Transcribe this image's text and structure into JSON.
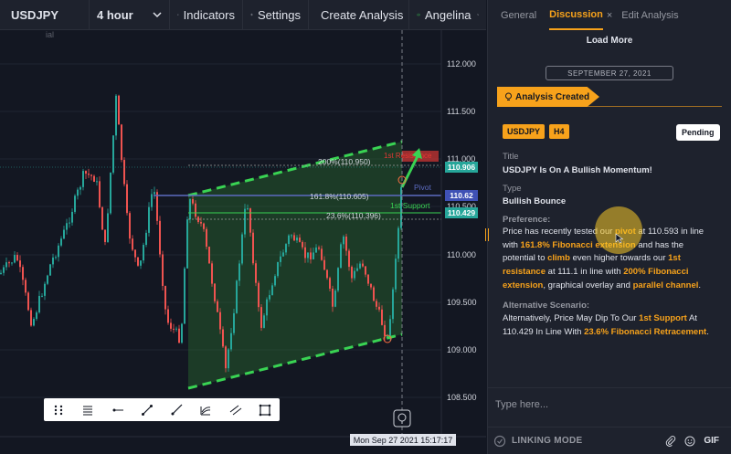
{
  "topbar": {
    "symbol": "USDJPY",
    "interval": "4 hour",
    "indicators": "Indicators",
    "settings": "Settings",
    "create_analysis": "Create Analysis",
    "user": "Angelina"
  },
  "chart": {
    "watermark": "ial",
    "price_axis": [
      "112.000",
      "111.500",
      "111.000",
      "110.500",
      "110.000",
      "109.500",
      "109.000",
      "108.500"
    ],
    "price_badges": {
      "green_top": "110.906",
      "blue": "110.62",
      "green_bottom": "110.429"
    },
    "fib_labels": {
      "fib_200": "200%(110.950)",
      "fib_161": "161.8%(110.605)",
      "fib_23": "23.6%(110.396)"
    },
    "annotations": {
      "pivot": "Pivot",
      "support": "1st Support",
      "resistance": "1st Resistance"
    },
    "crosshair_date": "Mon Sep 27 2021 15:17:17"
  },
  "panel": {
    "tabs": [
      "General",
      "Discussion",
      "Edit Analysis"
    ],
    "tab_close": "×",
    "load_more": "Load More",
    "date_separator": "SEPTEMBER 27, 2021",
    "banner": "Analysis Created",
    "badges": [
      "USDJPY",
      "H4"
    ],
    "status": "Pending",
    "title_label": "Title",
    "title_value": "USDJPY Is On A Bullish Momentum!",
    "type_label": "Type",
    "type_value": "Bullish Bounce",
    "preference_label": "Preference:",
    "preference": {
      "t1": "Price has recently tested our ",
      "h1": "pivot",
      "t2": " at 110.593 in line with ",
      "h2": "161.8% Fibonacci extension",
      "t3": " and has the potential to ",
      "h3": "climb",
      "t4": " even higher towards our ",
      "h4": "1st resistance",
      "t5": " at 111.1 in line with ",
      "h5": "200% Fibonacci extension",
      "t6": ", graphical overlay and ",
      "h6": "parallel channel",
      "t7": "."
    },
    "alt_label": "Alternative Scenario:",
    "alt": {
      "t1": "Alternatively, Price May Dip To Our ",
      "h1": "1st Support",
      "t2": " At 110.429 In Line With ",
      "h2": "23.6% Fibonacci Retracement",
      "t3": "."
    },
    "input_placeholder": "Type here...",
    "linking_mode": "LINKING MODE",
    "gif": "GIF"
  },
  "colors": {
    "accent": "#f7a21b",
    "bull": "#26a69a",
    "bear": "#ef5350",
    "channel": "#39d353"
  }
}
